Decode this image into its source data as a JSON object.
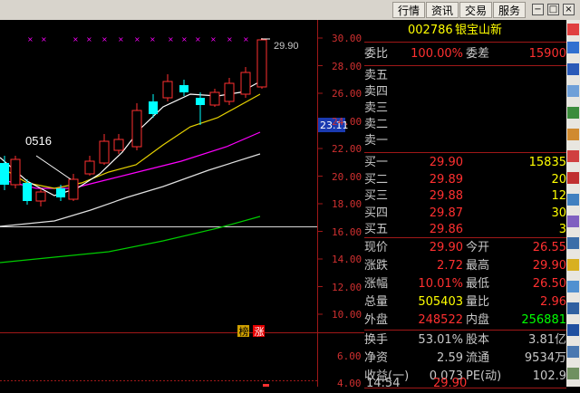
{
  "toolbar": {
    "buttons": [
      "行情",
      "资讯",
      "交易",
      "服务"
    ]
  },
  "window": {
    "controls": [
      "−",
      "□",
      "×"
    ]
  },
  "chart": {
    "price_ticks": [
      "30.00",
      "28.00",
      "26.00",
      "24.00",
      "22.00",
      "20.00",
      "18.00",
      "16.00",
      "14.00",
      "12.00",
      "10.00"
    ],
    "lower_ticks": [
      "6.00",
      "4.00"
    ],
    "high_label": "29.90",
    "pattern_label": "0516",
    "current_price_tag": "23.11",
    "badges": [
      "榜",
      "涨"
    ],
    "colors": {
      "up": "#ff3030",
      "down": "#00ffff",
      "ma5": "#ffffff",
      "ma10": "#e6d200",
      "ma20": "#ff00ff",
      "ma30": "#dcdcdc",
      "ma60": "#00cc00"
    }
  },
  "quote": {
    "code": "002786",
    "name": "银宝山新",
    "wei_bi_label": "委比",
    "wei_bi": "100.00%",
    "wei_cha_label": "委差",
    "wei_cha": "15900",
    "sell_labels": [
      "卖五",
      "卖四",
      "卖三",
      "卖二",
      "卖一"
    ],
    "buy": [
      {
        "label": "买一",
        "price": "29.90",
        "vol": "15835"
      },
      {
        "label": "买二",
        "price": "29.89",
        "vol": "20"
      },
      {
        "label": "买三",
        "price": "29.88",
        "vol": "12"
      },
      {
        "label": "买四",
        "price": "29.87",
        "vol": "30"
      },
      {
        "label": "买五",
        "price": "29.86",
        "vol": "3"
      }
    ],
    "stats": [
      {
        "l1": "现价",
        "v1": "29.90",
        "l2": "今开",
        "v2": "26.55",
        "c1": "#ff3030",
        "c2": "#ff3030"
      },
      {
        "l1": "涨跌",
        "v1": "2.72",
        "l2": "最高",
        "v2": "29.90",
        "c1": "#ff3030",
        "c2": "#ff3030"
      },
      {
        "l1": "涨幅",
        "v1": "10.01%",
        "l2": "最低",
        "v2": "26.50",
        "c1": "#ff3030",
        "c2": "#ff3030"
      },
      {
        "l1": "总量",
        "v1": "505403",
        "l2": "量比",
        "v2": "2.96",
        "c1": "#ffff00",
        "c2": "#ff3030"
      },
      {
        "l1": "外盘",
        "v1": "248522",
        "l2": "内盘",
        "v2": "256881",
        "c1": "#ff3030",
        "c2": "#00ff00"
      }
    ],
    "fund": [
      {
        "l1": "换手",
        "v1": "53.01%",
        "l2": "股本",
        "v2": "3.81亿"
      },
      {
        "l1": "净资",
        "v1": "2.59",
        "l2": "流通",
        "v2": "9534万"
      },
      {
        "l1": "收益(一)",
        "v1": "0.073",
        "l2": "PE(动)",
        "v2": "102.9"
      }
    ],
    "bottom_time": "14:54",
    "bottom_price": "29.90"
  }
}
